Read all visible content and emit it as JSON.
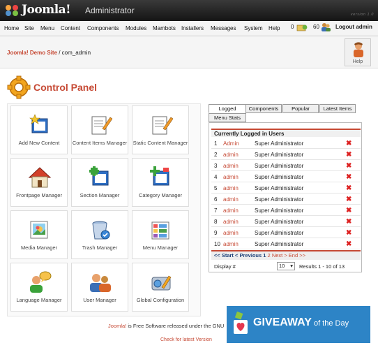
{
  "header": {
    "brand": "Joomla!",
    "subtitle": "Administrator",
    "version": "version 1.0"
  },
  "menu": {
    "items": [
      "Home",
      "Site",
      "Menu",
      "Content",
      "Components",
      "Modules",
      "Mambots",
      "Installers",
      "Messages",
      "System",
      "Help"
    ],
    "messages_count": "0",
    "users_online": "60",
    "logout_label": "Logout admin"
  },
  "breadcrumb": {
    "site": "Joomla! Demo Site",
    "path": " / com_admin"
  },
  "help": {
    "label": "Help"
  },
  "page": {
    "title": "Control Panel"
  },
  "tiles": [
    {
      "label": "Add New Content"
    },
    {
      "label": "Content Items Manager"
    },
    {
      "label": "Static Content Manager"
    },
    {
      "label": "Frontpage Manager"
    },
    {
      "label": "Section Manager"
    },
    {
      "label": "Category Manager"
    },
    {
      "label": "Media Manager"
    },
    {
      "label": "Trash Manager"
    },
    {
      "label": "Menu Manager"
    },
    {
      "label": "Language Manager"
    },
    {
      "label": "User Manager"
    },
    {
      "label": "Global Configuration"
    }
  ],
  "tabs": [
    "Logged",
    "Components",
    "Popular",
    "Latest Items",
    "Menu Stats"
  ],
  "logged": {
    "heading": "Currently Logged in Users",
    "rows": [
      {
        "n": "1",
        "user": "Admin",
        "role": "Super Administrator"
      },
      {
        "n": "2",
        "user": "admin",
        "role": "Super Administrator"
      },
      {
        "n": "3",
        "user": "admin",
        "role": "Super Administrator"
      },
      {
        "n": "4",
        "user": "admin",
        "role": "Super Administrator"
      },
      {
        "n": "5",
        "user": "admin",
        "role": "Super Administrator"
      },
      {
        "n": "6",
        "user": "admin",
        "role": "Super Administrator"
      },
      {
        "n": "7",
        "user": "admin",
        "role": "Super Administrator"
      },
      {
        "n": "8",
        "user": "admin",
        "role": "Super Administrator"
      },
      {
        "n": "9",
        "user": "admin",
        "role": "Super Administrator"
      },
      {
        "n": "10",
        "user": "admin",
        "role": "Super Administrator"
      }
    ],
    "pager": {
      "start": "<< Start",
      "prev": "< Previous",
      "current": "1",
      "page2": "2",
      "next": "Next >",
      "end": "End >>"
    },
    "display_label": "Display #",
    "display_value": "10",
    "results": "Results 1 - 10 of 13"
  },
  "footer": {
    "joomla": "Joomla!",
    "text": " is Free Software released under the GNU",
    "check": "Check for latest Version"
  },
  "banner": {
    "main": "GIVEAWAY",
    "tail": " of the Day"
  }
}
